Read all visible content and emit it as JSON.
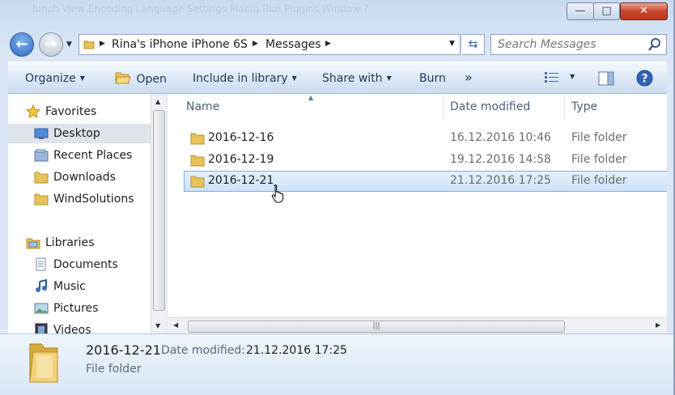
{
  "titlebar": {
    "ghost_text": "lunch  View  Encoding  Language  Settings  Macro  Run  Plugins  Window  ?",
    "minimize": "—",
    "maximize": "□",
    "close": "✕"
  },
  "address": {
    "crumbs": [
      "Rina's iPhone iPhone 6S",
      "Messages"
    ]
  },
  "search": {
    "placeholder": "Search Messages"
  },
  "toolbar": {
    "organize": "Organize",
    "open": "Open",
    "include_in_library": "Include in library",
    "share_with": "Share with",
    "burn": "Burn",
    "more": "»"
  },
  "nav": {
    "favorites": "Favorites",
    "desktop": "Desktop",
    "recent_places": "Recent Places",
    "downloads": "Downloads",
    "windsolutions": "WindSolutions",
    "libraries": "Libraries",
    "documents": "Documents",
    "music": "Music",
    "pictures": "Pictures",
    "videos": "Videos"
  },
  "columns": {
    "name": "Name",
    "date_modified": "Date modified",
    "type": "Type"
  },
  "files": [
    {
      "name": "2016-12-16",
      "date": "16.12.2016 10:46",
      "type": "File folder"
    },
    {
      "name": "2016-12-19",
      "date": "19.12.2016 14:58",
      "type": "File folder"
    },
    {
      "name": "2016-12-21",
      "date": "21.12.2016 17:25",
      "type": "File folder"
    }
  ],
  "details": {
    "name": "2016-12-21",
    "date_label": "Date modified:",
    "date_value": "21.12.2016 17:25",
    "type": "File folder"
  },
  "colors": {
    "selection": "#cbe1f7",
    "accent": "#2a69c4",
    "folder": "#e8c25a"
  }
}
